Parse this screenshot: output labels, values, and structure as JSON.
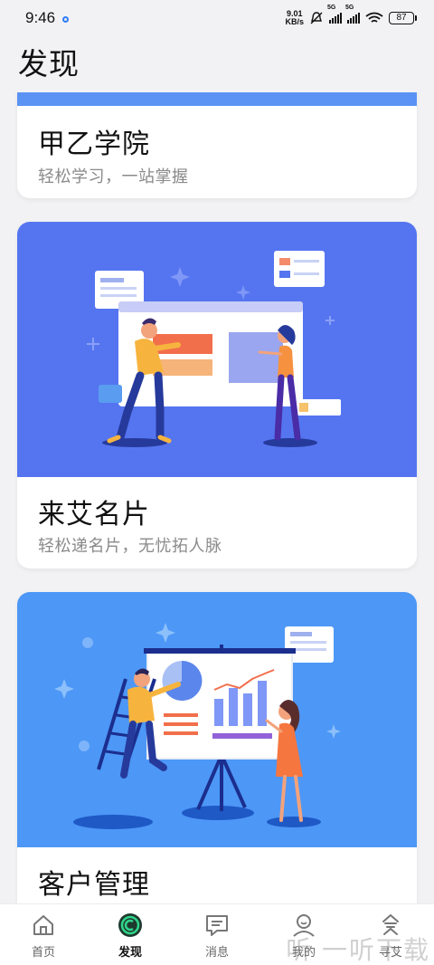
{
  "status_bar": {
    "time": "9:46",
    "net_speed_value": "9.01",
    "net_speed_unit": "KB/s",
    "signal1_label": "5G",
    "signal2_label": "5G",
    "battery": "87"
  },
  "page": {
    "title": "发现"
  },
  "cards": [
    {
      "title": "甲乙学院",
      "subtitle": "轻松学习，一站掌握",
      "banner_color": "#5b93f5"
    },
    {
      "title": "来艾名片",
      "subtitle": "轻松递名片，无忧拓人脉",
      "banner_color": "#5575f0"
    },
    {
      "title": "客户管理",
      "subtitle": "",
      "banner_color": "#4d97f6"
    }
  ],
  "tabbar": {
    "items": [
      {
        "label": "首页",
        "icon": "home-icon",
        "active": false
      },
      {
        "label": "发现",
        "icon": "discover-icon",
        "active": true
      },
      {
        "label": "消息",
        "icon": "message-icon",
        "active": false
      },
      {
        "label": "我的",
        "icon": "profile-icon",
        "active": false
      },
      {
        "label": "寻艾",
        "icon": "find-icon",
        "active": false
      }
    ]
  },
  "watermark": "听 一听下载"
}
